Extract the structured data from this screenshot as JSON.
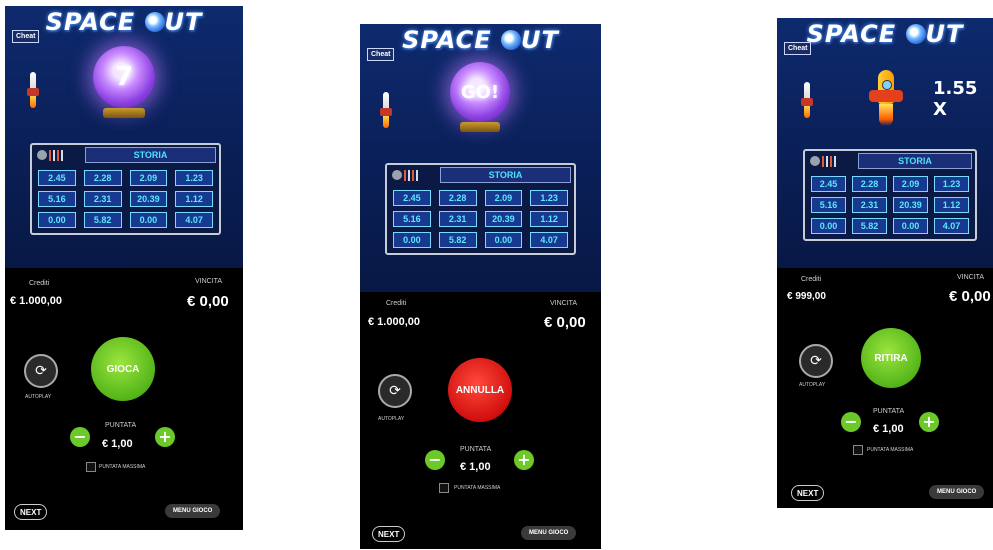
{
  "game_title_left": "SPACE",
  "game_title_right": "UT",
  "panels": [
    {
      "cheat": "Cheat",
      "orb_text": "7",
      "storia_title": "STORIA",
      "history": [
        "2.45",
        "2.28",
        "2.09",
        "1.23",
        "5.16",
        "2.31",
        "20.39",
        "1.12",
        "0.00",
        "5.82",
        "0.00",
        "4.07"
      ],
      "crediti_label": "Crediti",
      "crediti_value": "€ 1.000,00",
      "vincita_label": "VINCITA",
      "vincita_value": "€ 0,00",
      "autoplay_label": "AUTOPLAY",
      "main_button": "GIOCA",
      "puntata_label": "PUNTATA",
      "puntata_value": "€ 1,00",
      "max_label": "PUNTATA MASSIMA",
      "next_label": "NEXT",
      "menu_label": "MENU GIOCO"
    },
    {
      "cheat": "Cheat",
      "orb_text": "GO!",
      "storia_title": "STORIA",
      "history": [
        "2.45",
        "2.28",
        "2.09",
        "1.23",
        "5.16",
        "2.31",
        "20.39",
        "1.12",
        "0.00",
        "5.82",
        "0.00",
        "4.07"
      ],
      "crediti_label": "Crediti",
      "crediti_value": "€ 1.000,00",
      "vincita_label": "VINCITA",
      "vincita_value": "€ 0,00",
      "autoplay_label": "AUTOPLAY",
      "main_button": "ANNULLA",
      "puntata_label": "PUNTATA",
      "puntata_value": "€ 1,00",
      "max_label": "PUNTATA MASSIMA",
      "next_label": "NEXT",
      "menu_label": "MENU GIOCO"
    },
    {
      "cheat": "Cheat",
      "multiplier": "1.55 X",
      "storia_title": "STORIA",
      "history": [
        "2.45",
        "2.28",
        "2.09",
        "1.23",
        "5.16",
        "2.31",
        "20.39",
        "1.12",
        "0.00",
        "5.82",
        "0.00",
        "4.07"
      ],
      "crediti_label": "Crediti",
      "crediti_value": "€ 999,00",
      "vincita_label": "VINCITA",
      "vincita_value": "€ 0,00",
      "autoplay_label": "AUTOPLAY",
      "main_button": "RITIRA",
      "puntata_label": "PUNTATA",
      "puntata_value": "€ 1,00",
      "max_label": "PUNTATA MASSIMA",
      "next_label": "NEXT",
      "menu_label": "MENU GIOCO"
    }
  ],
  "colors": {
    "gioca": "#5cbf1f",
    "annulla": "#d41010",
    "ritira": "#5cbf1f",
    "history_text": "#5ce8ff"
  }
}
